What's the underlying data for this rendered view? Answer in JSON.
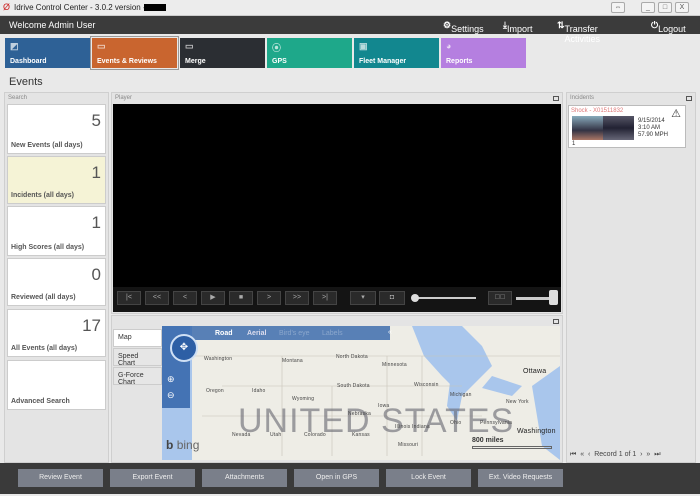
{
  "window": {
    "title": "Idrive Control Center - 3.0.2 version -",
    "minimize": "_",
    "maximize": "□",
    "close": "X"
  },
  "header": {
    "welcome": "Welcome Admin User",
    "settings": "Settings",
    "import": "Import",
    "transfer": "Transfer Activities",
    "logout": "Logout"
  },
  "tiles": [
    {
      "label": "Dashboard",
      "color": "#2e6196",
      "icon": "chart-icon"
    },
    {
      "label": "Events & Reviews",
      "color": "#c9652f",
      "icon": "clipboard-icon"
    },
    {
      "label": "Merge",
      "color": "#2b2e33",
      "icon": "merge-icon"
    },
    {
      "label": "GPS",
      "color": "#1ea88a",
      "icon": "map-pin-icon"
    },
    {
      "label": "Fleet Manager",
      "color": "#12878f",
      "icon": "truck-icon"
    },
    {
      "label": "Reports",
      "color": "#b57fe0",
      "icon": "pie-chart-icon"
    }
  ],
  "page_title": "Events",
  "search": {
    "title": "Search",
    "cards": [
      {
        "count": "5",
        "label": "New Events (all days)"
      },
      {
        "count": "1",
        "label": "Incidents (all days)",
        "selected": true
      },
      {
        "count": "1",
        "label": "High Scores (all days)"
      },
      {
        "count": "0",
        "label": "Reviewed (all days)"
      },
      {
        "count": "17",
        "label": "All Events (all days)"
      },
      {
        "count": "",
        "label": "Advanced Search"
      }
    ]
  },
  "player": {
    "title": "Player",
    "controls": [
      "|<",
      "<<",
      "<",
      "▶",
      "■",
      ">",
      ">>",
      ">|"
    ]
  },
  "map_panel": {
    "tabs": [
      "Map",
      "Speed Chart",
      "G-Force Chart"
    ],
    "map_modes": [
      "Road",
      "Aerial",
      "Bird's eye",
      "Labels"
    ],
    "country": "UNITED STATES",
    "brand": "bing",
    "scale": "800 miles",
    "labels": [
      "Washington",
      "Montana",
      "North Dakota",
      "Minnesota",
      "South Dakota",
      "Wisconsin",
      "Oregon",
      "Idaho",
      "Wyoming",
      "Michigan",
      "New York",
      "Iowa",
      "Nebraska",
      "Nevada",
      "Utah",
      "Colorado",
      "Kansas",
      "Missouri",
      "Ottawa",
      "Washington",
      "Illinois",
      "Indiana",
      "Ohio",
      "Pennsylvania"
    ]
  },
  "incidents": {
    "title": "Incidents",
    "item": {
      "name": "Shock - X01511832",
      "date": "9/15/2014",
      "time": "3:10 AM",
      "speed": "57.90 MPH",
      "index": "1"
    },
    "pager": "Record 1 of 1"
  },
  "actions": [
    "Review Event",
    "Export Event",
    "Attachments",
    "Open in GPS",
    "Lock Event",
    "Ext. Video Requests"
  ]
}
